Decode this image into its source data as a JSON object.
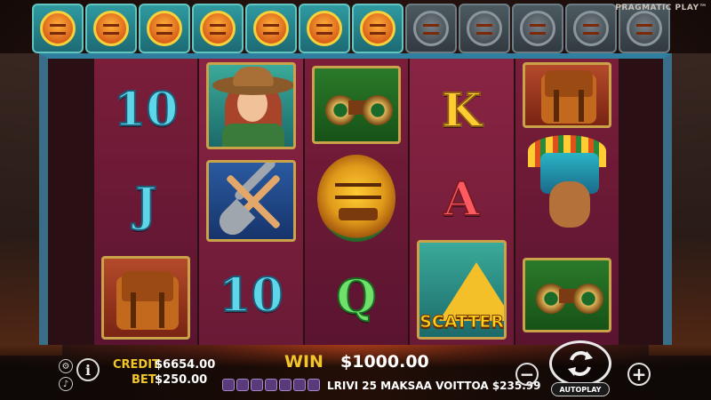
{
  "brand": "PRAGMATIC PLAY™",
  "multipliers": {
    "active_count": 7,
    "total": 12
  },
  "reels": [
    [
      {
        "type": "letter",
        "text": "10",
        "color": "cyan"
      },
      {
        "type": "letter",
        "text": "J",
        "color": "cyan"
      },
      {
        "type": "icon",
        "name": "backpack-icon"
      }
    ],
    [
      {
        "type": "icon",
        "name": "explorer-woman-icon"
      },
      {
        "type": "icon",
        "name": "pickaxe-shovel-icon"
      },
      {
        "type": "letter",
        "text": "10",
        "color": "cyan"
      }
    ],
    [
      {
        "type": "icon",
        "name": "binoculars-icon"
      },
      {
        "type": "icon",
        "name": "golden-mask-icon"
      },
      {
        "type": "letter",
        "text": "Q",
        "color": "green"
      }
    ],
    [
      {
        "type": "letter",
        "text": "K",
        "color": "yellow"
      },
      {
        "type": "letter",
        "text": "A",
        "color": "red"
      },
      {
        "type": "icon",
        "name": "scatter-pyramid-icon",
        "label": "SCATTER"
      }
    ],
    [
      {
        "type": "icon",
        "name": "backpack-icon"
      },
      {
        "type": "icon",
        "name": "aztec-warrior-icon"
      },
      {
        "type": "icon",
        "name": "binoculars-icon"
      }
    ]
  ],
  "footer": {
    "credit_label": "CREDIT",
    "credit_value": "$6654.00",
    "bet_label": "BET",
    "bet_value": "$250.00",
    "win_label": "WIN",
    "win_value": "$1000.00",
    "line_win_text": "LRIVI 25 MAKSAA VOITTOA $235.99",
    "info_label": "i",
    "minus_label": "−",
    "plus_label": "+",
    "autoplay_label": "AUTOPLAY"
  },
  "colors": {
    "label_gold": "#f1c62a",
    "reel_bg": "#7a1e3a",
    "frame_blue": "#3a6e86"
  }
}
